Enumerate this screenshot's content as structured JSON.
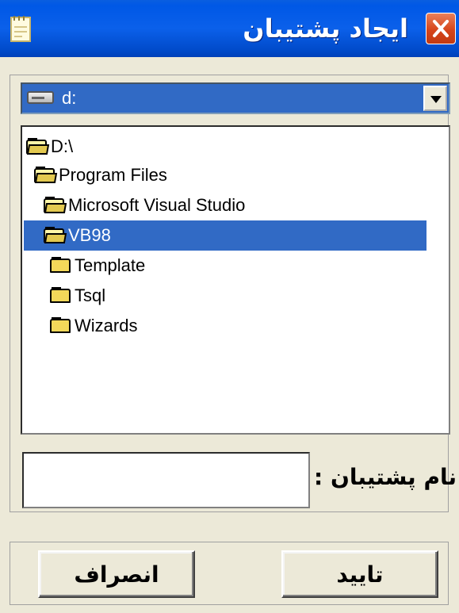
{
  "window": {
    "title": "ایجاد پشتیبان",
    "app_icon": "notepad-icon",
    "close_icon": "close-x-icon"
  },
  "drive_selector": {
    "value": "d:",
    "icon": "hard-drive-icon"
  },
  "folder_tree": {
    "items": [
      {
        "label": "D:\\",
        "icon": "open-folder-icon",
        "selected": false
      },
      {
        "label": "Program Files",
        "icon": "open-folder-icon",
        "selected": false
      },
      {
        "label": "Microsoft Visual Studio",
        "icon": "open-folder-icon",
        "selected": false
      },
      {
        "label": "VB98",
        "icon": "open-folder-icon",
        "selected": true
      },
      {
        "label": "Template",
        "icon": "folder-icon",
        "selected": false
      },
      {
        "label": "Tsql",
        "icon": "folder-icon",
        "selected": false
      },
      {
        "label": "Wizards",
        "icon": "folder-icon",
        "selected": false
      }
    ]
  },
  "backup_name": {
    "label": "نام پشتیبان :",
    "value": ""
  },
  "buttons": {
    "ok_label": "تایید",
    "cancel_label": "انصراف"
  },
  "colors": {
    "titlebar": "#0058e6",
    "selection": "#316ac5",
    "dialog_bg": "#ece9d8",
    "close_button": "#d7451b"
  }
}
